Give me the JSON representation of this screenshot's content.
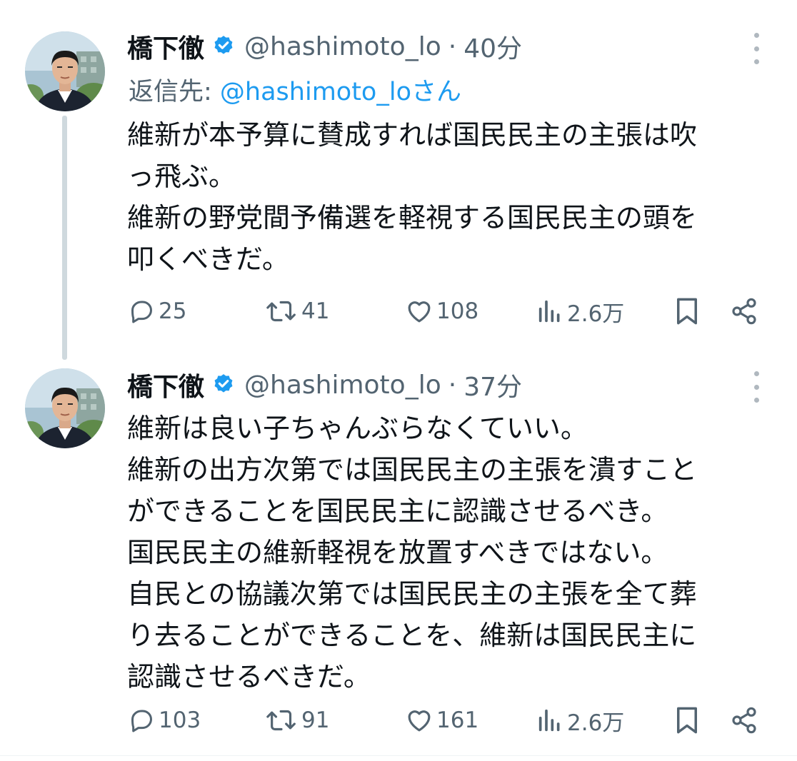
{
  "tweets": [
    {
      "author": {
        "name": "橋下徹",
        "handle": "@hashimoto_lo",
        "verified": true
      },
      "separator": "·",
      "time": "40分",
      "reply_to": {
        "prefix": "返信先: ",
        "user": "@hashimoto_loさん"
      },
      "body_lines": [
        "維新が本予算に賛成すれば国民民主の主張は吹",
        "っ飛ぶ。",
        "維新の野党間予備選を軽視する国民民主の頭を",
        "叩くべきだ。"
      ],
      "stats": {
        "replies": "25",
        "retweets": "41",
        "likes": "108",
        "views": "2.6万"
      }
    },
    {
      "author": {
        "name": "橋下徹",
        "handle": "@hashimoto_lo",
        "verified": true
      },
      "separator": "·",
      "time": "37分",
      "body_lines": [
        "維新は良い子ちゃんぶらなくていい。",
        "維新の出方次第では国民民主の主張を潰すこと",
        "ができることを国民民主に認識させるべき。",
        "国民民主の維新軽視を放置すべきではない。",
        "自民との協議次第では国民民主の主張を全て葬",
        "り去ることができることを、維新は国民民主に",
        "認識させるべきだ。"
      ],
      "stats": {
        "replies": "103",
        "retweets": "91",
        "likes": "161",
        "views": "2.6万"
      }
    }
  ],
  "icons": {
    "verified": "verified-badge-icon",
    "more": "more-options-icon",
    "reply": "reply-icon",
    "retweet": "retweet-icon",
    "like": "heart-icon",
    "views": "views-chart-icon",
    "bookmark": "bookmark-icon",
    "share": "share-icon"
  },
  "colors": {
    "text": "#0f1419",
    "secondary": "#536471",
    "accent": "#1d9bf0",
    "thread_line": "#cfd9de"
  }
}
